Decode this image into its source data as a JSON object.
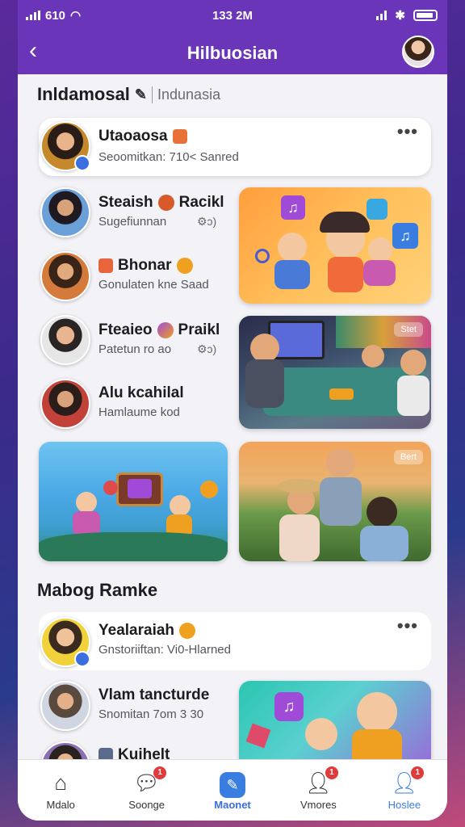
{
  "status": {
    "left_text": "610",
    "time": "133 2M"
  },
  "header": {
    "title": "Hilbuosian"
  },
  "section1": {
    "title": "Inldamosal",
    "subtitle": "Indunasia"
  },
  "featured": {
    "name": "Utaoaosa",
    "meta": "Seoomitkan: 710< Sanred"
  },
  "list": [
    {
      "name": "Steaish",
      "name2": "Racikl",
      "meta": "Sugefiunnan"
    },
    {
      "name": "Bhonar",
      "meta": "Gonulaten kne  Saad"
    },
    {
      "name": "Fteaieo",
      "name2": "Praikl",
      "meta": "Patetun ro ao"
    },
    {
      "name": "Alu kcahilal",
      "meta": "Hamlaume kod"
    }
  ],
  "thumbs": {
    "game_tag": "Stet",
    "park_tag": "Bert"
  },
  "section2": {
    "title": "Mabog Ramke"
  },
  "list2": [
    {
      "name": "Yealaraiah",
      "meta": "Gnstoriiftan: Vi0-Hlarned"
    },
    {
      "name": "Vlam tancturde",
      "meta": "Snomitan 7om  3 30"
    },
    {
      "name": "Kuihelt",
      "meta": ""
    }
  ],
  "tabs": [
    {
      "label": "Mdalo",
      "icon": "home-icon",
      "badge": ""
    },
    {
      "label": "Soonge",
      "icon": "chat-icon",
      "badge": "1"
    },
    {
      "label": "Maonet",
      "icon": "pen-icon",
      "badge": ""
    },
    {
      "label": "Vmores",
      "icon": "user-icon",
      "badge": "1"
    },
    {
      "label": "Hoslee",
      "icon": "profile-icon",
      "badge": "1"
    }
  ],
  "colors": {
    "primary": "#6a35b8",
    "accent": "#3a7de0",
    "badge": "#e23a3a"
  }
}
